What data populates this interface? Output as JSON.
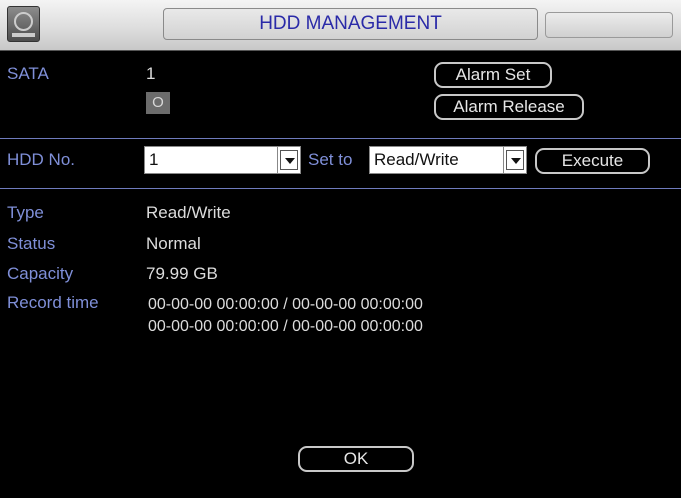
{
  "window": {
    "title": "HDD MANAGEMENT"
  },
  "sata": {
    "label": "SATA",
    "number": "1",
    "indicator": "O",
    "alarm_set": "Alarm Set",
    "alarm_release": "Alarm Release"
  },
  "hdd_row": {
    "label": "HDD No.",
    "hdd_no_value": "1",
    "set_to_label": "Set to",
    "mode_value": "Read/Write",
    "execute": "Execute"
  },
  "info": {
    "type_label": "Type",
    "type_value": "Read/Write",
    "status_label": "Status",
    "status_value": "Normal",
    "capacity_label": "Capacity",
    "capacity_value": "79.99 GB",
    "record_label": "Record time",
    "record_line1": "00-00-00 00:00:00 / 00-00-00 00:00:00",
    "record_line2": "00-00-00 00:00:00 / 00-00-00 00:00:00"
  },
  "footer": {
    "ok": "OK"
  },
  "colors": {
    "label": "#7f8fd8",
    "value": "#dcdcdc",
    "title_text": "#2a2aa8",
    "background": "#000000"
  },
  "icons": {
    "title_icon": "hdd-icon"
  }
}
